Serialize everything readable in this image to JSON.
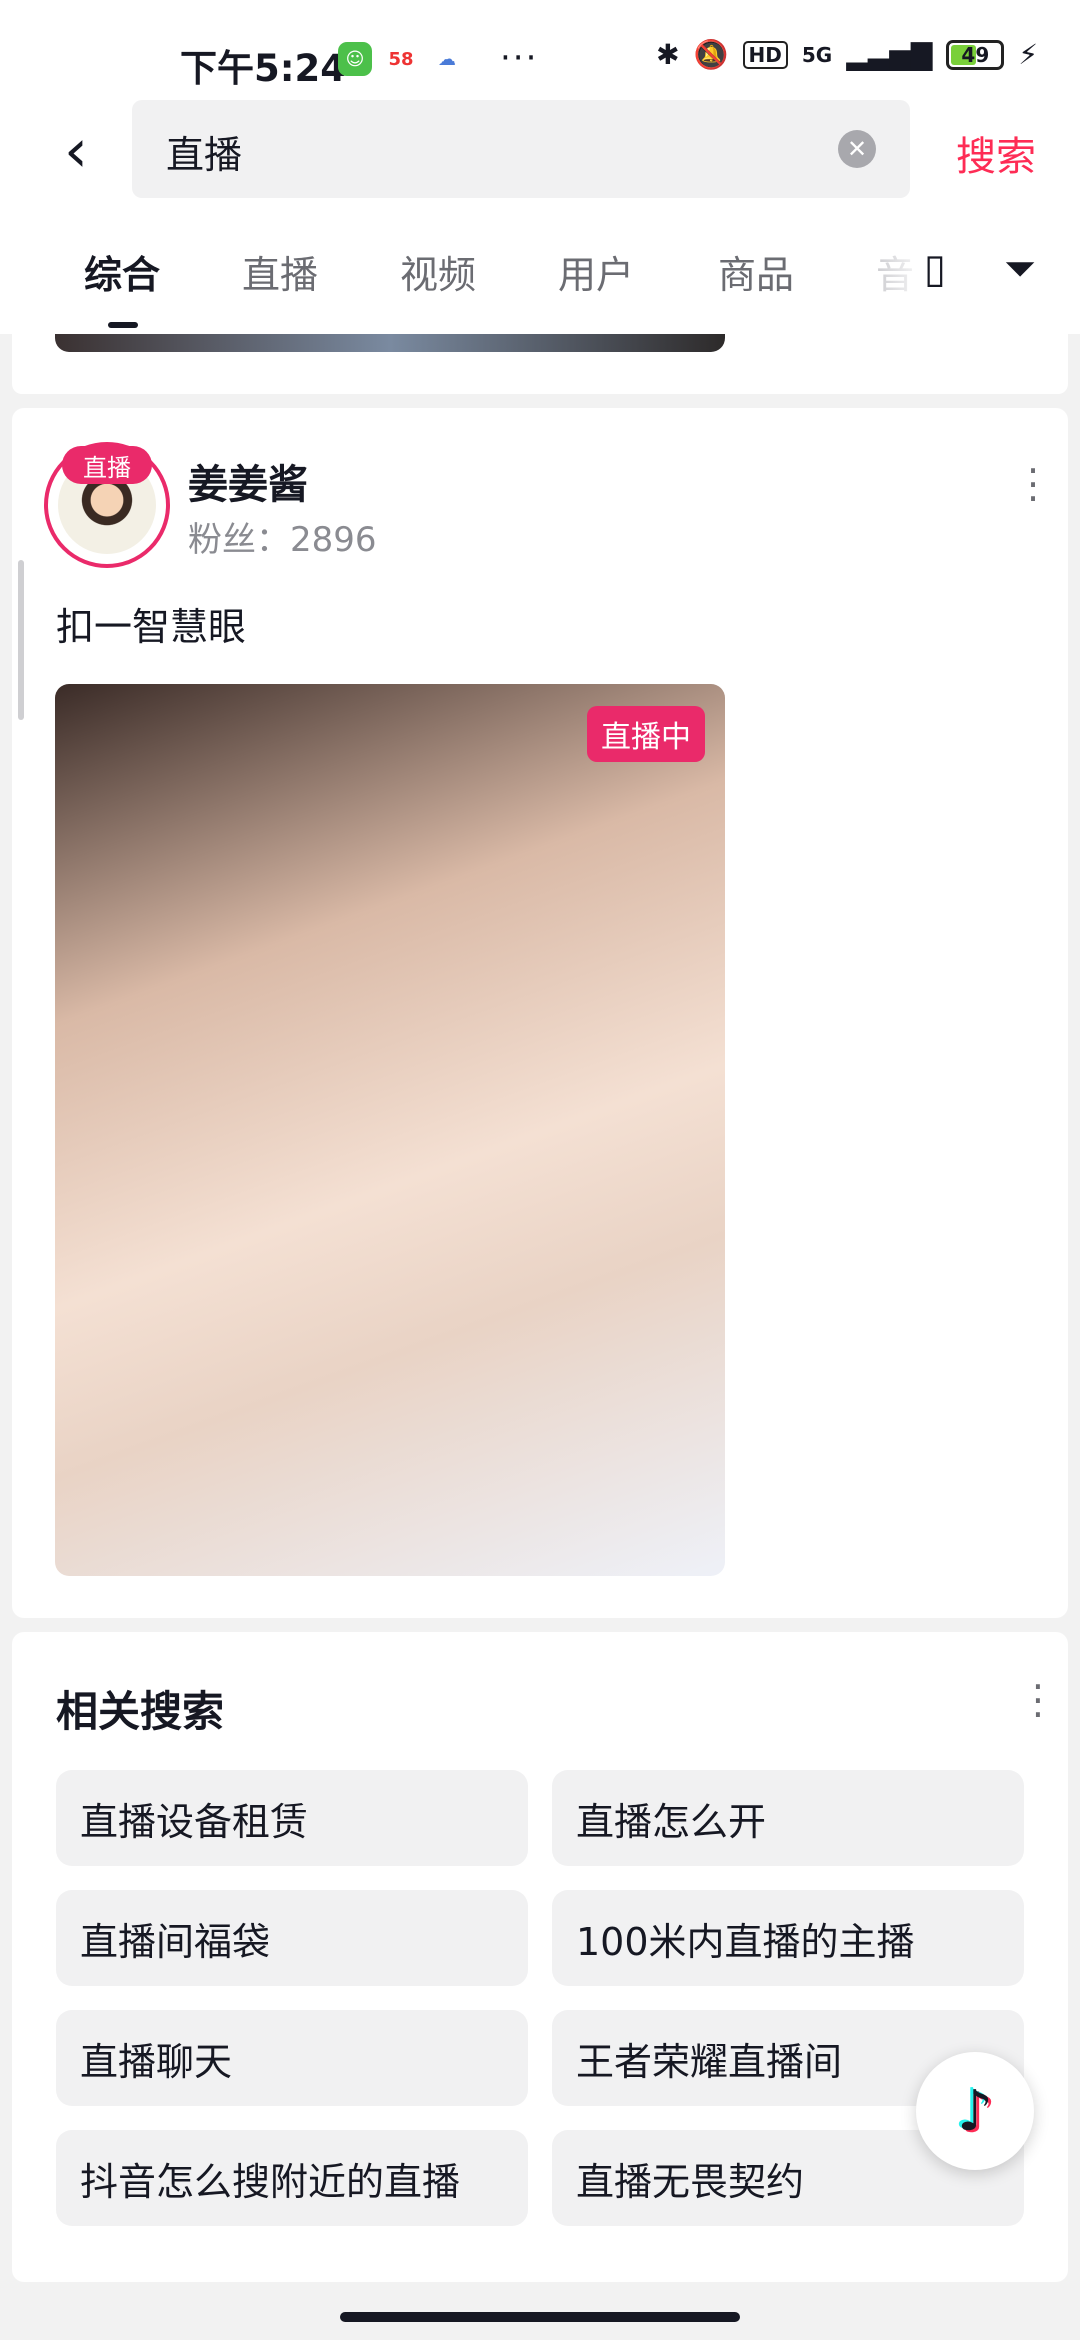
{
  "status_bar": {
    "time": "下午5:24",
    "more": "···",
    "network": "5G",
    "hd": "HD",
    "battery": "49",
    "apps": [
      "wechat-icon",
      "58-icon",
      "cloud-icon"
    ]
  },
  "search": {
    "back_icon": "‹",
    "query": "直播",
    "clear_icon": "✕",
    "button": "搜索"
  },
  "tabs": {
    "items": [
      "综合",
      "直播",
      "视频",
      "用户",
      "商品",
      "音"
    ],
    "active": "综合",
    "icons": [
      "tablet-icon",
      "filter-icon"
    ]
  },
  "result_card": {
    "avatar_badge": "直播",
    "user_name": "姜姜酱",
    "followers": "粉丝：2896",
    "caption": "扣一智慧眼",
    "live_tag": "直播中"
  },
  "related": {
    "title": "相关搜索",
    "items": [
      "直播设备租赁",
      "直播怎么开",
      "直播间福袋",
      "100米内直播的主播",
      "直播聊天",
      "王者荣耀直播间",
      "抖音怎么搜附近的直播",
      "直播无畏契约"
    ]
  },
  "fab": {
    "icon": "douyin-icon",
    "glyph": "♪"
  },
  "colors": {
    "accent": "#fe2c55",
    "live": "#ea2a6a"
  }
}
